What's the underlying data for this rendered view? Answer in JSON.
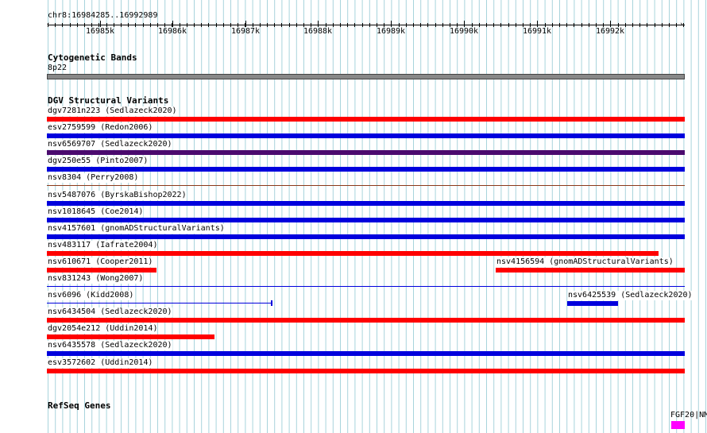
{
  "colors": {
    "grid": "#a8d4dc",
    "red": "#ff0000",
    "blue": "#0000dd",
    "purple": "#4b0a6e",
    "brown": "#8b3a1a",
    "band": "#888888",
    "gene": "#ff00ff"
  },
  "ruler": {
    "location": "chr8:16984285..16992989",
    "ticks": [
      "16985k",
      "16986k",
      "16987k",
      "16988k",
      "16989k",
      "16990k",
      "16991k",
      "16992k"
    ]
  },
  "cytobands": {
    "title": "Cytogenetic Bands",
    "band": "8p22"
  },
  "dgv": {
    "title": "DGV Structural Variants",
    "rows": [
      {
        "items": [
          {
            "label": "dgv7281n223 (Sedlazeck2020)",
            "color": "red",
            "start": 0,
            "end": 1
          }
        ]
      },
      {
        "items": [
          {
            "label": "esv2759599 (Redon2006)",
            "color": "blue",
            "start": 0,
            "end": 1
          }
        ]
      },
      {
        "items": [
          {
            "label": "nsv6569707 (Sedlazeck2020)",
            "color": "purple",
            "start": 0,
            "end": 1
          }
        ]
      },
      {
        "items": [
          {
            "label": "dgv250e55 (Pinto2007)",
            "color": "blue",
            "start": 0,
            "end": 1
          }
        ]
      },
      {
        "items": [
          {
            "label": "nsv8304 (Perry2008)",
            "color": "brown",
            "start": 0,
            "end": 1
          }
        ]
      },
      {
        "items": [
          {
            "label": "nsv5487076 (ByrskaBishop2022)",
            "color": "blue",
            "start": 0,
            "end": 1
          }
        ]
      },
      {
        "items": [
          {
            "label": "nsv1018645 (Coe2014)",
            "color": "blue",
            "start": 0,
            "end": 1
          }
        ]
      },
      {
        "items": [
          {
            "label": "nsv4157601 (gnomADStructuralVariants)",
            "color": "blue",
            "start": 0,
            "end": 1
          }
        ]
      },
      {
        "items": [
          {
            "label": "nsv483117 (Iafrate2004)",
            "color": "red",
            "start": 0,
            "end": 0.959
          }
        ]
      },
      {
        "items": [
          {
            "label": "nsv610671 (Cooper2011)",
            "color": "red",
            "start": 0,
            "end": 0.172
          },
          {
            "label": "nsv4156594 (gnomADStructuralVariants)",
            "color": "red",
            "start": 0.704,
            "end": 1
          }
        ]
      },
      {
        "items": [
          {
            "label": "nsv831243 (Wong2007)",
            "color": "thinblue",
            "start": 0,
            "end": 1
          }
        ]
      },
      {
        "items": [
          {
            "label": "nsv6096 (Kidd2008)",
            "color": "kidd",
            "start": 0,
            "end": 0.353
          },
          {
            "label": "nsv6425539 (Sedlazeck2020)",
            "color": "blue",
            "start": 0.816,
            "end": 0.896
          }
        ]
      },
      {
        "items": [
          {
            "label": "nsv6434504 (Sedlazeck2020)",
            "color": "red",
            "start": 0,
            "end": 1
          }
        ]
      },
      {
        "items": [
          {
            "label": "dgv2054e212 (Uddin2014)",
            "color": "red",
            "start": 0,
            "end": 0.263
          }
        ]
      },
      {
        "items": [
          {
            "label": "nsv6435578 (Sedlazeck2020)",
            "color": "blue",
            "start": 0,
            "end": 1
          }
        ]
      },
      {
        "items": [
          {
            "label": "esv3572602 (Uddin2014)",
            "color": "red",
            "start": 0,
            "end": 1
          }
        ]
      }
    ]
  },
  "refseq": {
    "title": "RefSeq Genes",
    "gene_label": "FGF20|NM"
  }
}
